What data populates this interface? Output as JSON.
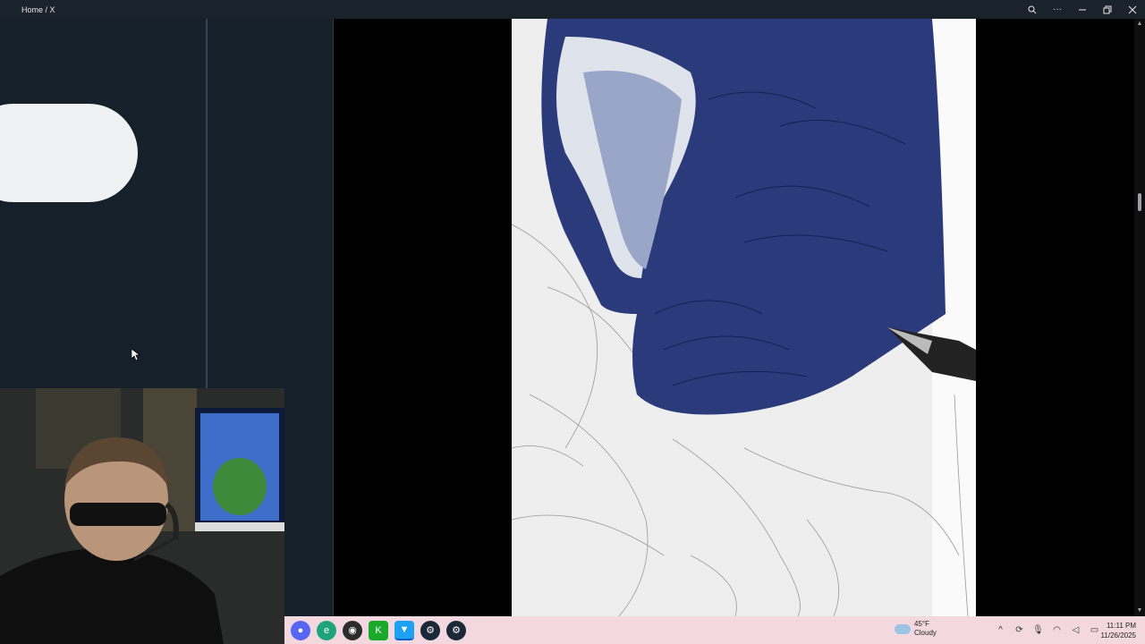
{
  "titlebar": {
    "title": "Home / X",
    "zoom_icon": "zoom-icon",
    "more_icon": "more-icon",
    "minimize_icon": "minimize-icon",
    "restore_icon": "restore-icon",
    "close_icon": "close-icon"
  },
  "taskbar": {
    "pinned": [
      {
        "name": "discord-icon",
        "color": "#5865f2"
      },
      {
        "name": "edge-icon",
        "color": "#1fa37a"
      },
      {
        "name": "obs-icon",
        "color": "#2b2b2b"
      },
      {
        "name": "krita-icon",
        "color": "#1ba92b"
      },
      {
        "name": "twitter-icon",
        "color": "#1da1f2"
      },
      {
        "name": "steam-icon",
        "color": "#1b2838"
      },
      {
        "name": "steam-icon",
        "color": "#1b2838"
      }
    ],
    "weather": {
      "temp": "45°F",
      "condition": "Cloudy"
    },
    "clock": {
      "time": "11:11 PM",
      "date": "11/26/2025"
    }
  },
  "colors": {
    "background": "#15202b",
    "taskbar": "#f3d9df",
    "pill": "#eef2f2",
    "ink": "#1b2a6b"
  }
}
